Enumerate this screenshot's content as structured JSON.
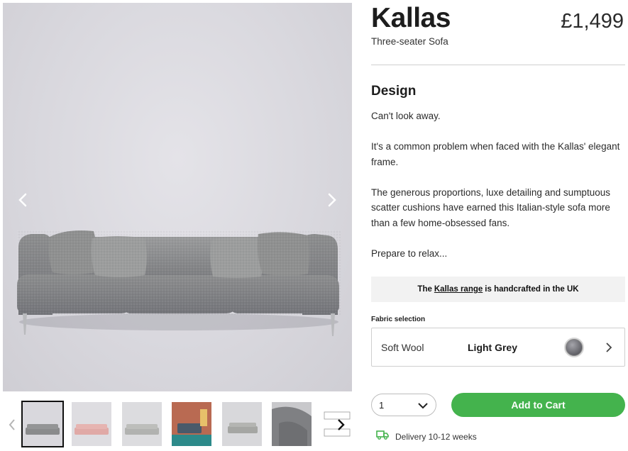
{
  "product": {
    "name": "Kallas",
    "type": "Three-seater Sofa",
    "price": "£1,499"
  },
  "design": {
    "heading": "Design",
    "paragraphs": [
      "Can't look away.",
      "It's a common problem when faced with the Kallas' elegant frame.",
      "The generous proportions, luxe detailing and sumptuous scatter cushions have earned this Italian-style sofa more than a few home-obsessed fans.",
      "Prepare to relax..."
    ]
  },
  "handcrafted": {
    "prefix": "The",
    "link": "Kallas range",
    "suffix": "is handcrafted in the UK"
  },
  "fabric": {
    "label": "Fabric selection",
    "type": "Soft Wool",
    "color": "Light Grey"
  },
  "cart": {
    "quantity": "1",
    "add_label": "Add to Cart",
    "delivery": "Delivery 10-12 weeks"
  },
  "gallery": {
    "thumbnails": [
      "grey-sofa",
      "pink-sofa",
      "light-grey-sofa",
      "sofa-room-red-wall",
      "sofa-side-view",
      "sofa-detail-close-up",
      "sofa-line-drawing"
    ],
    "active_thumbnail": 1
  },
  "colors": {
    "accent_green": "#44b34d",
    "sofa_grey": "#8a8b8c",
    "pink_sofa": "#e0a9a6"
  }
}
